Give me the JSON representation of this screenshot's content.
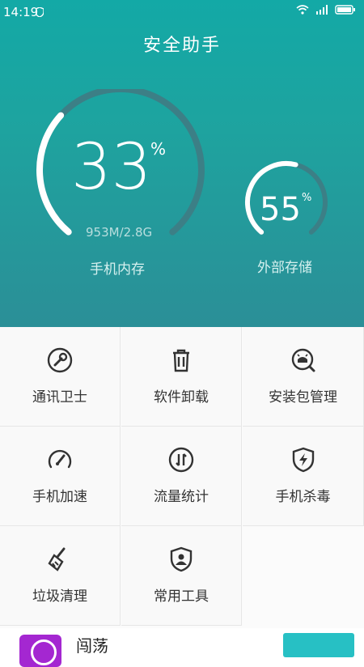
{
  "status_bar": {
    "time": "14:19"
  },
  "header": {
    "title": "安全助手",
    "memory": {
      "percent": "33",
      "percent_symbol": "%",
      "usage": "953M/2.8G",
      "label": "手机内存",
      "fraction": 0.33
    },
    "storage": {
      "percent": "55",
      "percent_symbol": "%",
      "label": "外部存储",
      "fraction": 0.55
    }
  },
  "tools": [
    {
      "label": "通讯卫士",
      "icon": "wrench-icon"
    },
    {
      "label": "软件卸载",
      "icon": "trash-icon"
    },
    {
      "label": "安装包管理",
      "icon": "android-package-icon"
    },
    {
      "label": "手机加速",
      "icon": "speedometer-icon"
    },
    {
      "label": "流量统计",
      "icon": "data-traffic-icon"
    },
    {
      "label": "手机杀毒",
      "icon": "shield-bolt-icon"
    },
    {
      "label": "垃圾清理",
      "icon": "broom-icon"
    },
    {
      "label": "常用工具",
      "icon": "shield-user-icon"
    }
  ],
  "recommended_app": {
    "name": "闯荡"
  },
  "colors": {
    "header_top": "#13a9a6",
    "header_bottom": "#2b8f97",
    "accent_button": "#27c0c4",
    "app_icon": "#a427d1"
  }
}
